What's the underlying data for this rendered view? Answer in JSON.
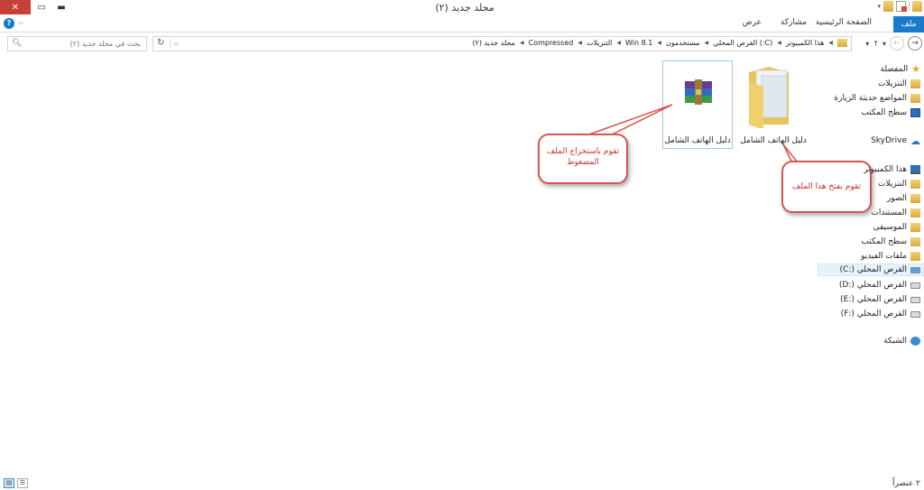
{
  "window": {
    "title": "مجلد جديد (٢)",
    "close_label": "✕",
    "maximize_label": "▭",
    "minimize_label": "▬"
  },
  "ribbon": {
    "tabs": [
      "ملف",
      "الصفحة الرئيسية",
      "مشاركة",
      "عرض"
    ],
    "help_label": "?",
    "collapse_label": "⌵"
  },
  "search": {
    "placeholder": "بحث في مجلد جديد (٢)"
  },
  "address": {
    "crumbs": [
      "هذا الكمبيوتر",
      "القرص المحلي (:C)",
      "مستخدمون",
      "Win 8.1",
      "التنزيلات",
      "Compressed",
      "مجلد جديد (٢)"
    ]
  },
  "items": [
    {
      "name": "دليل الهاتف الشامل",
      "type": "folder"
    },
    {
      "name": "دليل الهاتف الشامل",
      "type": "rar-archive",
      "selected": true
    }
  ],
  "callouts": {
    "extract": "تقوم باستخراج الملف المضغوط",
    "open": "تقوم بفتح هذا الملف"
  },
  "sidebar": {
    "favorites": {
      "label": "المفضلة",
      "items": [
        "التنزيلات",
        "المواضع حديثة الزيارة",
        "سطح المكتب"
      ]
    },
    "skydrive": "SkyDrive",
    "this_pc": {
      "label": "هذا الكمبيوتر",
      "items": [
        "التنزيلات",
        "الصور",
        "المستندات",
        "الموسيقى",
        "سطح المكتب",
        "ملفات الفيديو",
        "القرص المحلي (:C)",
        "القرص المحلي (:D)",
        "القرص المحلي (:E)",
        "القرص المحلي (:F)"
      ]
    },
    "network": "الشبكة"
  },
  "status": {
    "item_count": "٢ عنصراً"
  },
  "colors": {
    "accent": "#1979ca",
    "callout_border": "#d9534f",
    "close_button": "#c7403a"
  }
}
